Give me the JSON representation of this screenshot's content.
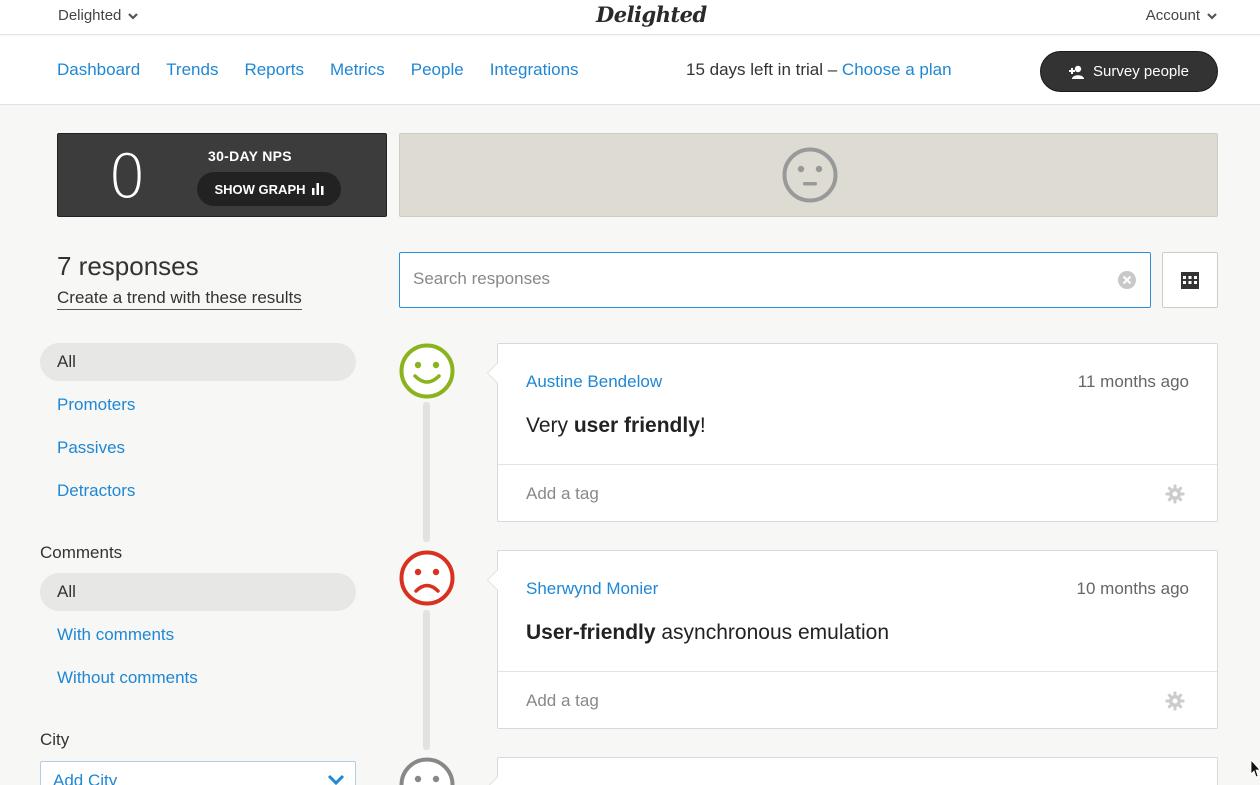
{
  "topbar": {
    "org": "Delighted",
    "logo": "Delighted",
    "account": "Account"
  },
  "nav": {
    "links": [
      "Dashboard",
      "Trends",
      "Reports",
      "Metrics",
      "People",
      "Integrations"
    ],
    "trial_text": "15 days left in trial – ",
    "trial_link": "Choose a plan",
    "survey_button": "Survey people"
  },
  "nps": {
    "score": "0",
    "label": "30-DAY NPS",
    "graph_button": "SHOW GRAPH"
  },
  "sidebar": {
    "response_count": "7 responses",
    "trend_link": "Create a trend with these results",
    "filters": [
      "All",
      "Promoters",
      "Passives",
      "Detractors"
    ],
    "comments_label": "Comments",
    "comment_filters": [
      "All",
      "With comments",
      "Without comments"
    ],
    "city_label": "City",
    "city_select": "Add City"
  },
  "search": {
    "placeholder": "Search responses"
  },
  "responses": [
    {
      "name": "Austine Bendelow",
      "time": "11 months ago",
      "comment_pre": "Very ",
      "comment_bold": "user friendly",
      "comment_post": "!",
      "tag_placeholder": "Add a tag",
      "sentiment": "promoter"
    },
    {
      "name": "Sherwynd Monier",
      "time": "10 months ago",
      "comment_pre": "",
      "comment_bold": "User-friendly",
      "comment_post": " asynchronous emulation",
      "tag_placeholder": "Add a tag",
      "sentiment": "detractor"
    }
  ],
  "colors": {
    "link": "#1f87d4",
    "promoter": "#8bb31d",
    "detractor": "#d9311f",
    "passive": "#888888"
  }
}
